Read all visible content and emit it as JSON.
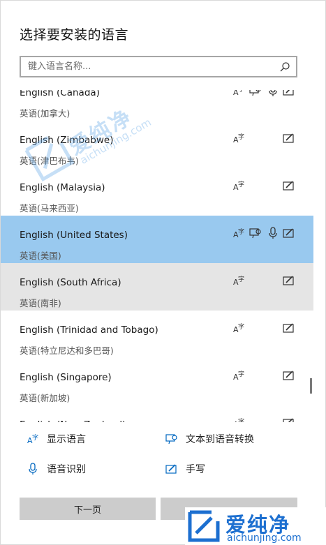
{
  "dialog": {
    "title": "选择要安装的语言",
    "search": {
      "placeholder": "键入语言名称..."
    }
  },
  "languages": [
    {
      "name": "English (Canada)",
      "native": "英语(加拿大)",
      "features": [
        "display",
        "tts",
        "speech",
        "handwriting"
      ],
      "state": "normal"
    },
    {
      "name": "English (Zimbabwe)",
      "native": "英语(津巴布韦)",
      "features": [
        "display",
        "handwriting"
      ],
      "state": "normal"
    },
    {
      "name": "English (Malaysia)",
      "native": "英语(马来西亚)",
      "features": [
        "display",
        "handwriting"
      ],
      "state": "normal"
    },
    {
      "name": "English (United States)",
      "native": "英语(美国)",
      "features": [
        "display",
        "tts",
        "speech",
        "handwriting"
      ],
      "state": "selected"
    },
    {
      "name": "English (South Africa)",
      "native": "英语(南非)",
      "features": [
        "display",
        "handwriting"
      ],
      "state": "hover"
    },
    {
      "name": "English (Trinidad and Tobago)",
      "native": "英语(特立尼达和多巴哥)",
      "features": [
        "display",
        "handwriting"
      ],
      "state": "normal"
    },
    {
      "name": "English (Singapore)",
      "native": "英语(新加坡)",
      "features": [
        "display",
        "handwriting"
      ],
      "state": "normal"
    },
    {
      "name": "English (New Zealand)",
      "native": "",
      "features": [
        "display",
        "handwriting"
      ],
      "state": "normal"
    }
  ],
  "legend": {
    "display_language": "显示语言",
    "text_to_speech": "文本到语音转换",
    "speech_recognition": "语音识别",
    "handwriting": "手写"
  },
  "buttons": {
    "next": "下一页",
    "cancel": ""
  },
  "watermark": {
    "cn": "爱纯净",
    "en": "aichunjing.com"
  },
  "colors": {
    "selected_row": "#99c9ef",
    "hover_row": "#e5e5e5",
    "button_bg": "#cccccc",
    "accent": "#0067c0",
    "watermark": "#1c6fd0"
  }
}
